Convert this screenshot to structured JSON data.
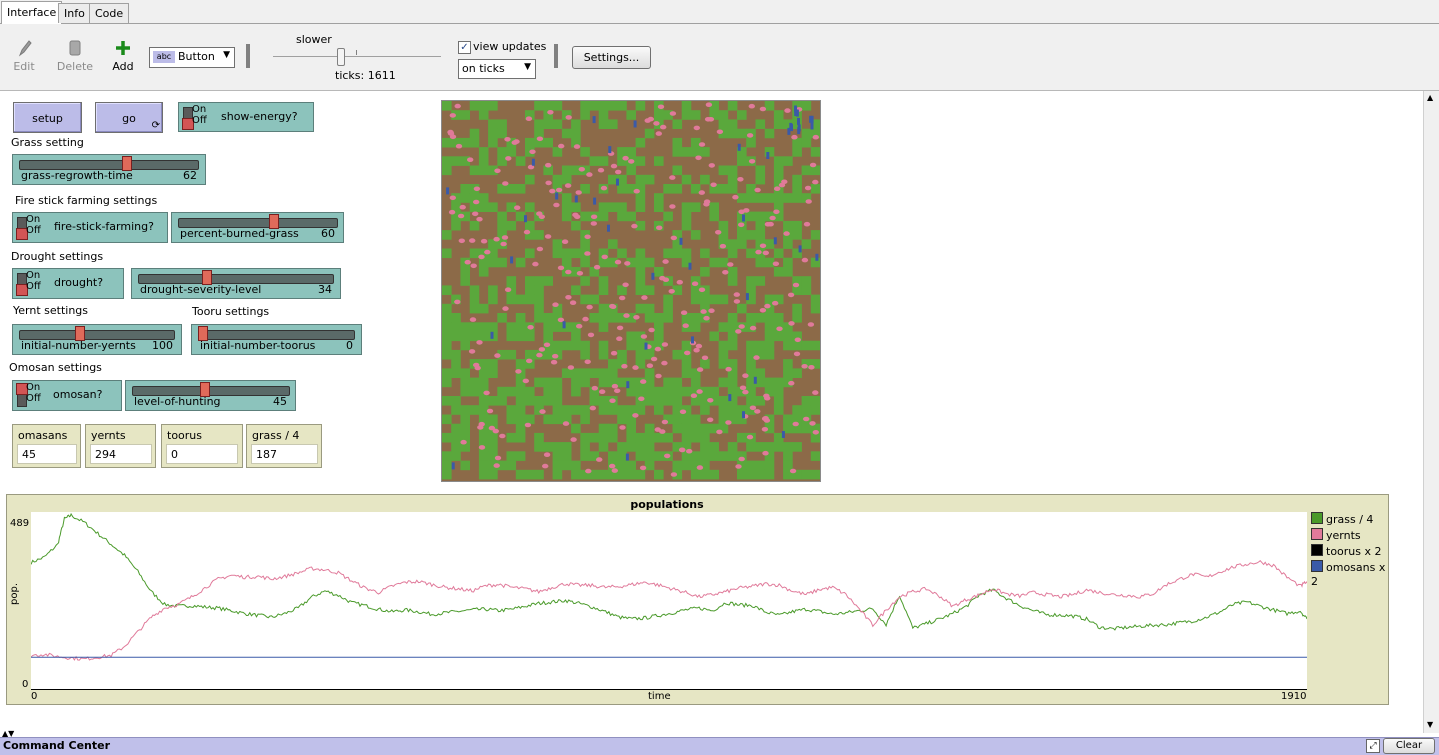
{
  "tabs": [
    {
      "label": "Interface"
    },
    {
      "label": "Info"
    },
    {
      "label": "Code"
    }
  ],
  "toolbar": {
    "edit_label": "Edit",
    "delete_label": "Delete",
    "add_label": "Add",
    "widget_type": "Button",
    "speed_label": "slower",
    "ticks_label": "ticks: 1611",
    "view_updates_label": "view updates",
    "view_updates_checked": true,
    "update_mode": "on ticks",
    "settings_label": "Settings..."
  },
  "buttons": {
    "setup": "setup",
    "go": "go"
  },
  "switches": {
    "on": "On",
    "off": "Off",
    "show_energy": "show-energy?",
    "fire_stick": "fire-stick-farming?",
    "drought": "drought?",
    "omosan": "omosan?"
  },
  "notes": {
    "grass": "Grass setting",
    "fire": "Fire stick farming settings",
    "drought": "Drought settings",
    "yernt": "Yernt settings",
    "tooru": "Tooru settings",
    "omosan": "Omosan settings"
  },
  "sliders": {
    "grass_regrowth": {
      "name": "grass-regrowth-time",
      "value": "62",
      "fraction": 0.6
    },
    "percent_burned": {
      "name": "percent-burned-grass",
      "value": "60",
      "fraction": 0.6
    },
    "drought_level": {
      "name": "drought-severity-level",
      "value": "34",
      "fraction": 0.34
    },
    "init_yernts": {
      "name": "initial-number-yernts",
      "value": "100",
      "fraction": 0.38
    },
    "init_toorus": {
      "name": "initial-number-toorus",
      "value": "0",
      "fraction": 0.0
    },
    "hunting": {
      "name": "level-of-hunting",
      "value": "45",
      "fraction": 0.45
    }
  },
  "monitors": [
    {
      "label": "omasans",
      "value": "45"
    },
    {
      "label": "yernts",
      "value": "294"
    },
    {
      "label": "toorus",
      "value": "0"
    },
    {
      "label": "grass / 4",
      "value": "187"
    }
  ],
  "command_center": {
    "title": "Command Center",
    "clear_label": "Clear"
  },
  "colors": {
    "grass": "#5aa83c",
    "yernt": "#e07a9a",
    "tooru": "#000000",
    "omosan": "#3a5aa8",
    "dirt": "#8c6a48"
  },
  "chart_data": {
    "type": "line",
    "title": "populations",
    "xlabel": "time",
    "ylabel": "pop.",
    "xlim": [
      0,
      1910
    ],
    "ylim": [
      0,
      489
    ],
    "x_tick_labels": [
      "0",
      "1910"
    ],
    "y_tick_labels": [
      "0",
      "489"
    ],
    "legend_placement": "right",
    "series": [
      {
        "name": "grass / 4",
        "color": "#4a9a2a",
        "points": [
          [
            0,
            350
          ],
          [
            20,
            365
          ],
          [
            40,
            400
          ],
          [
            50,
            470
          ],
          [
            60,
            480
          ],
          [
            80,
            460
          ],
          [
            100,
            430
          ],
          [
            120,
            400
          ],
          [
            140,
            370
          ],
          [
            160,
            325
          ],
          [
            180,
            270
          ],
          [
            200,
            235
          ],
          [
            220,
            230
          ],
          [
            240,
            232
          ],
          [
            260,
            228
          ],
          [
            280,
            225
          ],
          [
            300,
            218
          ],
          [
            320,
            210
          ],
          [
            340,
            205
          ],
          [
            360,
            200
          ],
          [
            380,
            210
          ],
          [
            400,
            225
          ],
          [
            420,
            255
          ],
          [
            440,
            272
          ],
          [
            460,
            260
          ],
          [
            480,
            240
          ],
          [
            500,
            232
          ],
          [
            520,
            222
          ],
          [
            540,
            215
          ],
          [
            560,
            220
          ],
          [
            580,
            215
          ],
          [
            600,
            208
          ],
          [
            620,
            212
          ],
          [
            640,
            216
          ],
          [
            660,
            220
          ],
          [
            680,
            222
          ],
          [
            700,
            218
          ],
          [
            720,
            222
          ],
          [
            740,
            230
          ],
          [
            760,
            238
          ],
          [
            780,
            242
          ],
          [
            800,
            246
          ],
          [
            820,
            238
          ],
          [
            840,
            228
          ],
          [
            860,
            215
          ],
          [
            880,
            200
          ],
          [
            900,
            195
          ],
          [
            920,
            198
          ],
          [
            940,
            205
          ],
          [
            960,
            212
          ],
          [
            980,
            220
          ],
          [
            1000,
            225
          ],
          [
            1020,
            218
          ],
          [
            1040,
            240
          ],
          [
            1060,
            234
          ],
          [
            1080,
            232
          ],
          [
            1100,
            214
          ],
          [
            1120,
            205
          ],
          [
            1140,
            215
          ],
          [
            1160,
            222
          ],
          [
            1180,
            216
          ],
          [
            1200,
            208
          ],
          [
            1220,
            212
          ],
          [
            1240,
            218
          ],
          [
            1260,
            223
          ],
          [
            1280,
            180
          ],
          [
            1300,
            260
          ],
          [
            1320,
            170
          ],
          [
            1340,
            182
          ],
          [
            1360,
            195
          ],
          [
            1380,
            210
          ],
          [
            1400,
            230
          ],
          [
            1420,
            262
          ],
          [
            1440,
            275
          ],
          [
            1460,
            252
          ],
          [
            1480,
            232
          ],
          [
            1500,
            218
          ],
          [
            1520,
            207
          ],
          [
            1540,
            206
          ],
          [
            1560,
            203
          ],
          [
            1580,
            195
          ],
          [
            1600,
            172
          ],
          [
            1620,
            168
          ],
          [
            1640,
            172
          ],
          [
            1660,
            175
          ],
          [
            1680,
            178
          ],
          [
            1700,
            180
          ],
          [
            1720,
            185
          ],
          [
            1740,
            190
          ],
          [
            1760,
            200
          ],
          [
            1780,
            215
          ],
          [
            1800,
            235
          ],
          [
            1820,
            242
          ],
          [
            1840,
            230
          ],
          [
            1860,
            220
          ],
          [
            1880,
            210
          ],
          [
            1900,
            217
          ],
          [
            1910,
            195
          ]
        ]
      },
      {
        "name": "yernts",
        "color": "#e07a9a",
        "points": [
          [
            0,
            95
          ],
          [
            20,
            98
          ],
          [
            40,
            92
          ],
          [
            60,
            88
          ],
          [
            80,
            85
          ],
          [
            100,
            90
          ],
          [
            120,
            95
          ],
          [
            140,
            120
          ],
          [
            160,
            160
          ],
          [
            180,
            200
          ],
          [
            200,
            225
          ],
          [
            220,
            235
          ],
          [
            240,
            255
          ],
          [
            260,
            280
          ],
          [
            280,
            305
          ],
          [
            300,
            315
          ],
          [
            320,
            310
          ],
          [
            340,
            312
          ],
          [
            360,
            305
          ],
          [
            380,
            312
          ],
          [
            400,
            322
          ],
          [
            420,
            334
          ],
          [
            440,
            330
          ],
          [
            460,
            322
          ],
          [
            480,
            300
          ],
          [
            500,
            280
          ],
          [
            520,
            268
          ],
          [
            540,
            285
          ],
          [
            560,
            296
          ],
          [
            580,
            298
          ],
          [
            600,
            290
          ],
          [
            620,
            282
          ],
          [
            640,
            278
          ],
          [
            660,
            272
          ],
          [
            680,
            286
          ],
          [
            700,
            290
          ],
          [
            720,
            282
          ],
          [
            740,
            278
          ],
          [
            760,
            270
          ],
          [
            780,
            282
          ],
          [
            800,
            292
          ],
          [
            820,
            288
          ],
          [
            840,
            287
          ],
          [
            860,
            282
          ],
          [
            880,
            284
          ],
          [
            900,
            290
          ],
          [
            920,
            296
          ],
          [
            940,
            288
          ],
          [
            960,
            278
          ],
          [
            980,
            268
          ],
          [
            1000,
            256
          ],
          [
            1020,
            262
          ],
          [
            1040,
            270
          ],
          [
            1060,
            280
          ],
          [
            1080,
            285
          ],
          [
            1100,
            292
          ],
          [
            1120,
            288
          ],
          [
            1140,
            272
          ],
          [
            1160,
            262
          ],
          [
            1180,
            276
          ],
          [
            1200,
            282
          ],
          [
            1220,
            262
          ],
          [
            1240,
            222
          ],
          [
            1260,
            178
          ],
          [
            1280,
            220
          ],
          [
            1300,
            256
          ],
          [
            1320,
            270
          ],
          [
            1340,
            278
          ],
          [
            1360,
            258
          ],
          [
            1380,
            230
          ],
          [
            1400,
            248
          ],
          [
            1420,
            262
          ],
          [
            1440,
            278
          ],
          [
            1460,
            264
          ],
          [
            1480,
            258
          ],
          [
            1500,
            268
          ],
          [
            1520,
            262
          ],
          [
            1540,
            256
          ],
          [
            1560,
            262
          ],
          [
            1580,
            275
          ],
          [
            1600,
            268
          ],
          [
            1620,
            262
          ],
          [
            1640,
            260
          ],
          [
            1660,
            256
          ],
          [
            1680,
            265
          ],
          [
            1700,
            290
          ],
          [
            1720,
            305
          ],
          [
            1740,
            318
          ],
          [
            1760,
            310
          ],
          [
            1780,
            325
          ],
          [
            1800,
            338
          ],
          [
            1820,
            346
          ],
          [
            1840,
            352
          ],
          [
            1860,
            342
          ],
          [
            1880,
            310
          ],
          [
            1900,
            285
          ],
          [
            1910,
            298
          ]
        ]
      },
      {
        "name": "toorus x 2",
        "color": "#000000",
        "points": [
          [
            0,
            0
          ],
          [
            1910,
            0
          ]
        ]
      },
      {
        "name": "omosans x 2",
        "color": "#3a5aa8",
        "points": [
          [
            0,
            90
          ],
          [
            1910,
            90
          ]
        ]
      }
    ]
  }
}
